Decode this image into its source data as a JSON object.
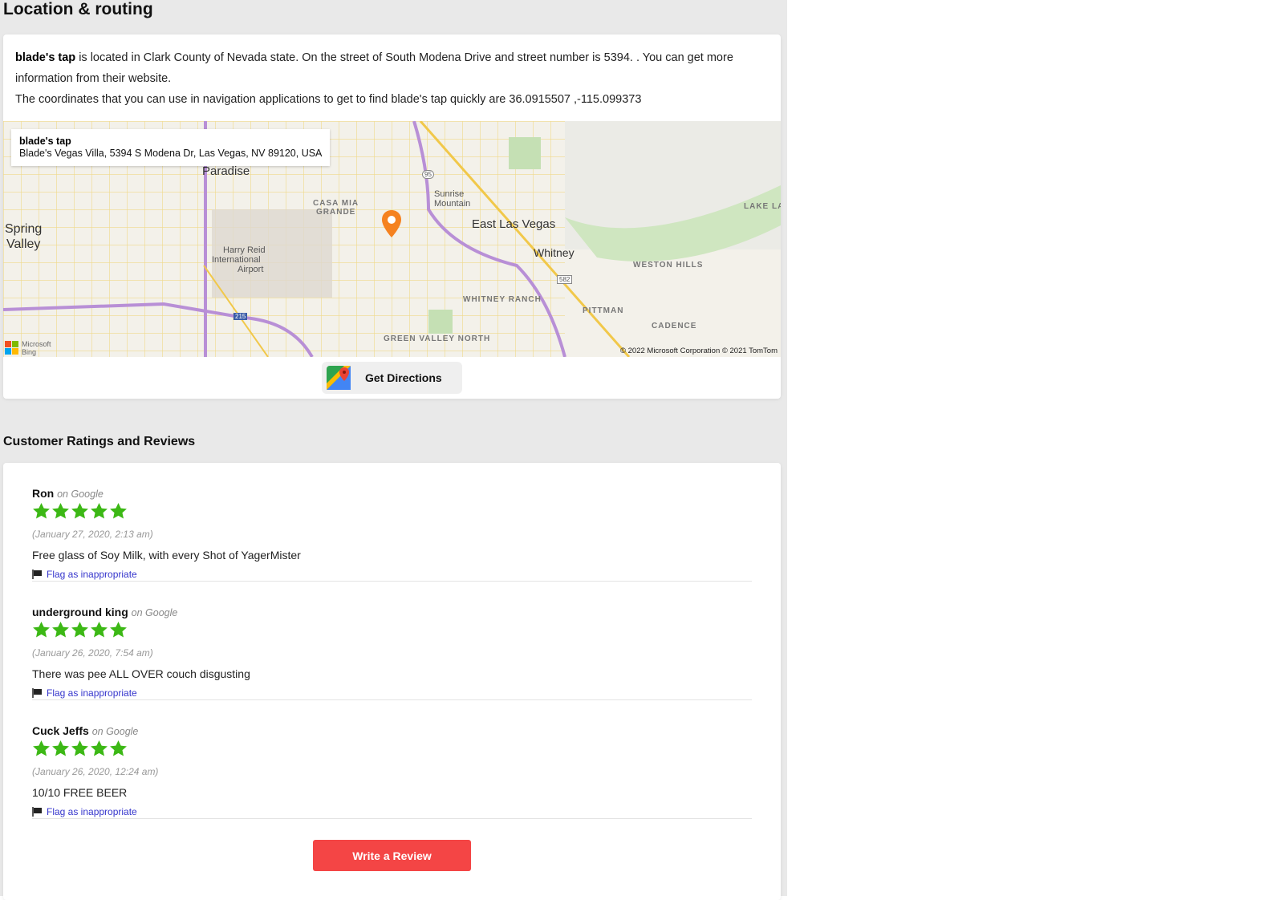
{
  "location": {
    "title": "Location & routing",
    "business_name": "blade's tap",
    "intro_rest": " is located in Clark County of Nevada state. On the street of South Modena Drive and street number is 5394. . You can get more information from their website.",
    "coordinates_text": "The coordinates that you can use in navigation applications to get to find blade's tap quickly are 36.0915507 ,-115.099373",
    "map": {
      "popup_title": "blade's tap",
      "popup_address": "Blade's Vegas Villa, 5394 S Modena Dr, Las Vegas, NV 89120, USA",
      "labels": [
        "Paradise",
        "Spring",
        "Valley",
        "CASA MIA",
        "GRANDE",
        "Sunrise",
        "Mountain",
        "East Las Vegas",
        "Harry Reid",
        "International",
        "Airport",
        "Whitney",
        "WESTON HILLS",
        "WHITNEY RANCH",
        "PITTMAN",
        "CADENCE",
        "GREEN VALLEY NORTH",
        "LAKE LA",
        "95",
        "582",
        "215"
      ],
      "copyright": "© 2022 Microsoft Corporation © 2021 TomTom",
      "bing_brand": [
        "Microsoft",
        "Bing"
      ],
      "pin_color": "#f58220"
    },
    "directions_label": "Get Directions"
  },
  "reviews": {
    "title": "Customer Ratings and Reviews",
    "star_color": "#3cb815",
    "items": [
      {
        "name": "Ron",
        "source": "on Google",
        "rating": 5,
        "date": "(January 27, 2020, 2:13 am)",
        "text": "Free glass of Soy Milk, with every Shot of YagerMister",
        "flag": "Flag as inappropriate"
      },
      {
        "name": "underground king",
        "source": "on Google",
        "rating": 5,
        "date": "(January 26, 2020, 7:54 am)",
        "text": "There was pee ALL OVER couch disgusting",
        "flag": "Flag as inappropriate"
      },
      {
        "name": "Cuck Jeffs",
        "source": "on Google",
        "rating": 5,
        "date": "(January 26, 2020, 12:24 am)",
        "text": "10/10 FREE BEER",
        "flag": "Flag as inappropriate"
      }
    ],
    "write_label": "Write a Review",
    "write_color": "#f44545"
  }
}
